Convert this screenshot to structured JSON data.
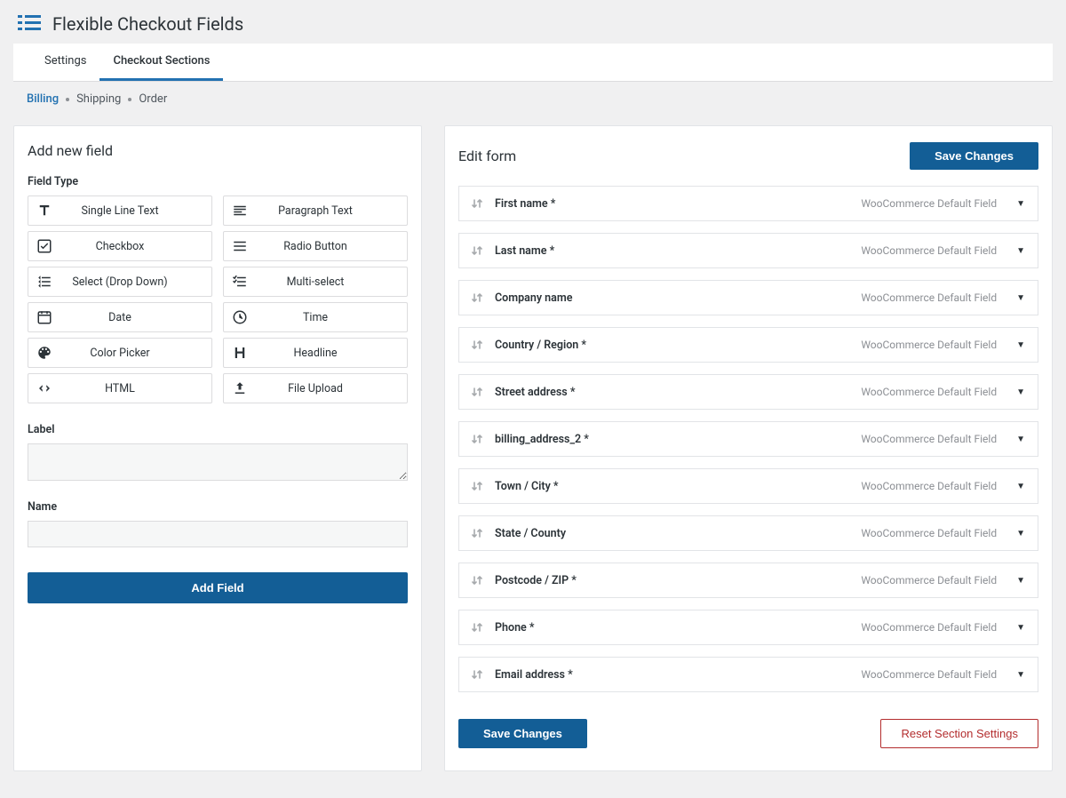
{
  "header": {
    "title": "Flexible Checkout Fields"
  },
  "tabs": [
    {
      "label": "Settings",
      "active": false
    },
    {
      "label": "Checkout Sections",
      "active": true
    }
  ],
  "subnav": [
    {
      "label": "Billing",
      "active": true
    },
    {
      "label": "Shipping",
      "active": false
    },
    {
      "label": "Order",
      "active": false
    }
  ],
  "left": {
    "title": "Add new field",
    "field_type_label": "Field Type",
    "types": [
      {
        "label": "Single Line Text",
        "icon": "text"
      },
      {
        "label": "Paragraph Text",
        "icon": "paragraph"
      },
      {
        "label": "Checkbox",
        "icon": "checkbox"
      },
      {
        "label": "Radio Button",
        "icon": "radio"
      },
      {
        "label": "Select (Drop Down)",
        "icon": "select"
      },
      {
        "label": "Multi-select",
        "icon": "multiselect"
      },
      {
        "label": "Date",
        "icon": "date"
      },
      {
        "label": "Time",
        "icon": "time"
      },
      {
        "label": "Color Picker",
        "icon": "color"
      },
      {
        "label": "Headline",
        "icon": "headline"
      },
      {
        "label": "HTML",
        "icon": "html"
      },
      {
        "label": "File Upload",
        "icon": "upload"
      }
    ],
    "label_label": "Label",
    "name_label": "Name",
    "add_button": "Add Field"
  },
  "right": {
    "title": "Edit form",
    "save_button": "Save Changes",
    "reset_button": "Reset Section Settings",
    "default_meta": "WooCommerce Default Field",
    "fields": [
      {
        "label": "First name *"
      },
      {
        "label": "Last name *"
      },
      {
        "label": "Company name"
      },
      {
        "label": "Country / Region *"
      },
      {
        "label": "Street address *"
      },
      {
        "label": "billing_address_2 *"
      },
      {
        "label": "Town / City *"
      },
      {
        "label": "State / County"
      },
      {
        "label": "Postcode / ZIP *"
      },
      {
        "label": "Phone *"
      },
      {
        "label": "Email address *"
      }
    ]
  }
}
